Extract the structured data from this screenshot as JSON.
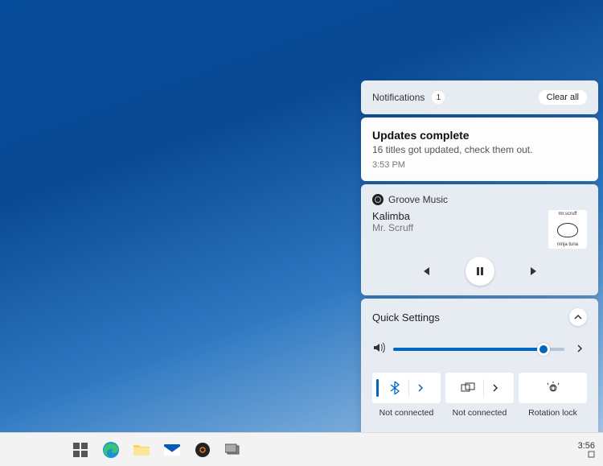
{
  "notifications": {
    "header_label": "Notifications",
    "count": "1",
    "clear_label": "Clear all",
    "items": [
      {
        "title": "Updates complete",
        "body": "16 titles got updated, check them out.",
        "time": "3:53 PM"
      }
    ]
  },
  "media": {
    "app_name": "Groove Music",
    "track": "Kalimba",
    "artist": "Mr. Scruff",
    "album_top": "mr.scruff",
    "album_bottom": "ninja tuna"
  },
  "quick_settings": {
    "header_label": "Quick Settings",
    "volume_percent": 88,
    "tiles": [
      {
        "label": "Not connected",
        "icon": "bluetooth"
      },
      {
        "label": "Not connected",
        "icon": "project"
      },
      {
        "label": "Rotation lock",
        "icon": "rotation"
      }
    ]
  },
  "taskbar": {
    "clock": "3:56"
  }
}
